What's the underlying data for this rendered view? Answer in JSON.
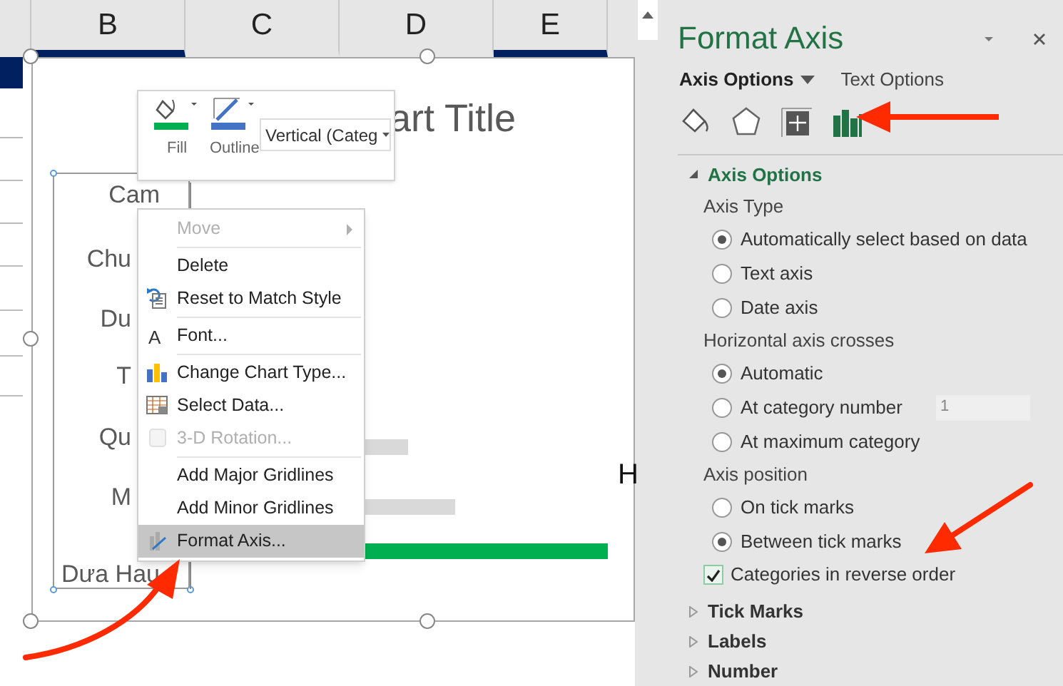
{
  "sheet": {
    "columns": [
      {
        "label": "B",
        "highlighted": true
      },
      {
        "label": "C",
        "highlighted": false
      },
      {
        "label": "D",
        "highlighted": false
      },
      {
        "label": "E",
        "highlighted": true
      }
    ]
  },
  "chart": {
    "title": "art Title",
    "axis_labels": [
      "Cam",
      "Chu",
      "Du",
      "T",
      "Qu",
      "M",
      "Dưa Hau"
    ],
    "side_label": "H"
  },
  "mini_toolbar": {
    "buttons": [
      {
        "label": "Fill"
      },
      {
        "label": "Outline"
      }
    ],
    "element_selector": "Vertical (Categ"
  },
  "context_menu": {
    "groups": [
      [
        {
          "label": "Move",
          "disabled": true,
          "submenu": true,
          "selected": false
        }
      ],
      [
        {
          "label": "Delete",
          "disabled": false,
          "submenu": false,
          "selected": false
        },
        {
          "label": "Reset to Match Style",
          "disabled": false,
          "submenu": false,
          "selected": false
        }
      ],
      [
        {
          "label": "Font...",
          "icon_text": "A",
          "disabled": false,
          "submenu": false,
          "selected": false
        }
      ],
      [
        {
          "label": "Change Chart Type...",
          "disabled": false,
          "submenu": false,
          "selected": false
        },
        {
          "label": "Select Data...",
          "disabled": false,
          "submenu": false,
          "selected": false
        },
        {
          "label": "3-D Rotation...",
          "disabled": true,
          "submenu": false,
          "selected": false
        }
      ],
      [
        {
          "label": "Add Major Gridlines",
          "disabled": false,
          "submenu": false,
          "selected": false
        },
        {
          "label": "Add Minor Gridlines",
          "disabled": false,
          "submenu": false,
          "selected": false
        },
        {
          "label": "Format Axis...",
          "disabled": false,
          "submenu": false,
          "selected": true
        }
      ]
    ]
  },
  "pane": {
    "title": "Format Axis",
    "tabs": [
      {
        "label": "Axis Options",
        "selected": true
      },
      {
        "label": "Text Options",
        "selected": false
      }
    ],
    "icon_tabs": [
      {
        "selected": false
      },
      {
        "selected": false
      },
      {
        "selected": false
      },
      {
        "selected": true
      }
    ],
    "sections": [
      {
        "label": "Axis Options",
        "expanded": true,
        "rows": [
          {
            "kind": "heading",
            "label": "Axis Type"
          },
          {
            "kind": "radio",
            "label": "Automatically select based on data",
            "selected": true
          },
          {
            "kind": "radio",
            "label": "Text axis",
            "selected": false
          },
          {
            "kind": "radio",
            "label": "Date axis",
            "selected": false
          },
          {
            "kind": "heading",
            "label": "Horizontal axis crosses"
          },
          {
            "kind": "radio",
            "label": "Automatic",
            "selected": true
          },
          {
            "kind": "radio",
            "label": "At category number",
            "selected": false,
            "value": "1"
          },
          {
            "kind": "radio",
            "label": "At maximum category",
            "selected": false
          },
          {
            "kind": "heading",
            "label": "Axis position"
          },
          {
            "kind": "radio",
            "label": "On tick marks",
            "selected": false
          },
          {
            "kind": "radio",
            "label": "Between tick marks",
            "selected": true
          },
          {
            "kind": "checkbox",
            "label": "Categories in reverse order",
            "checked": true
          }
        ]
      },
      {
        "label": "Tick Marks",
        "expanded": false
      },
      {
        "label": "Labels",
        "expanded": false
      },
      {
        "label": "Number",
        "expanded": false
      }
    ]
  }
}
